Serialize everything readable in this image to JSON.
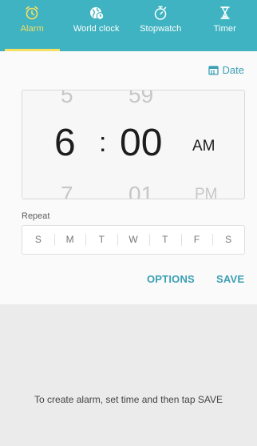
{
  "tabs": [
    {
      "label": "Alarm",
      "icon": "alarm-clock-icon",
      "active": true
    },
    {
      "label": "World clock",
      "icon": "globe-clock-icon",
      "active": false
    },
    {
      "label": "Stopwatch",
      "icon": "stopwatch-icon",
      "active": false
    },
    {
      "label": "Timer",
      "icon": "hourglass-icon",
      "active": false
    }
  ],
  "date_button": {
    "label": "Date",
    "icon": "calendar-icon"
  },
  "time_picker": {
    "hour_prev": "5",
    "hour": "6",
    "hour_next": "7",
    "separator": ":",
    "minute_prev": "59",
    "minute": "00",
    "minute_next": "01",
    "ampm": "AM",
    "ampm_next": "PM"
  },
  "repeat": {
    "label": "Repeat",
    "days": [
      "S",
      "M",
      "T",
      "W",
      "T",
      "F",
      "S"
    ]
  },
  "actions": {
    "options_label": "OPTIONS",
    "save_label": "SAVE"
  },
  "hint": "To create alarm, set time and then tap SAVE",
  "colors": {
    "tab_bar": "#3fb3c1",
    "active_tab": "#f6df63",
    "accent": "#3a9fb4"
  }
}
